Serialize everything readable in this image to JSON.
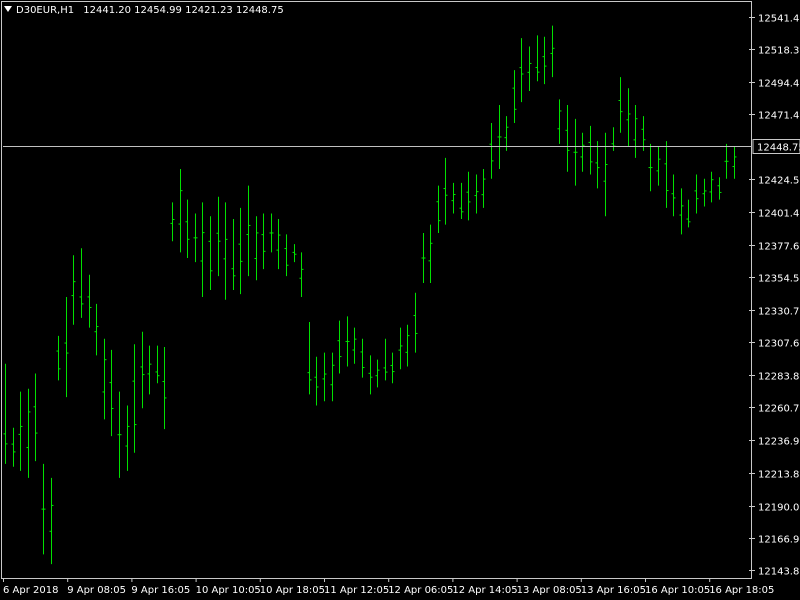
{
  "header": {
    "symbol": "D30EUR,H1",
    "open": "12441.20",
    "high": "12454.99",
    "low": "12421.23",
    "close": "12448.75"
  },
  "colors": {
    "background": "#000000",
    "bars": "#00e000",
    "grid_frame": "#c8c8c8",
    "price_line": "#c0c0c0",
    "text": "#ffffff"
  },
  "chart_data": {
    "type": "ohlc",
    "title": "",
    "xlabel": "",
    "ylabel": "",
    "ylim": [
      12138.0,
      12552.0
    ],
    "y_ticks": [
      "12541.40",
      "12518.30",
      "12494.40",
      "12471.40",
      "12424.50",
      "12401.40",
      "12377.60",
      "12354.50",
      "12330.70",
      "12307.60",
      "12283.80",
      "12260.70",
      "12236.90",
      "12213.80",
      "12190.00",
      "12166.90",
      "12143.80"
    ],
    "x_tick_labels": [
      "6 Apr 2018",
      "9 Apr 08:05",
      "9 Apr 16:05",
      "10 Apr 10:05",
      "10 Apr 18:05",
      "11 Apr 12:05",
      "12 Apr 06:05",
      "12 Apr 14:05",
      "13 Apr 08:05",
      "13 Apr 16:05",
      "16 Apr 10:05",
      "16 Apr 18:05"
    ],
    "current_price": "12448.75",
    "grid": false,
    "bars_hl": [
      [
        12292,
        12220
      ],
      [
        12246,
        12218
      ],
      [
        12272,
        12215
      ],
      [
        12274,
        12210
      ],
      [
        12285,
        12222
      ],
      [
        12220,
        12155
      ],
      [
        12210,
        12148
      ],
      [
        12312,
        12280
      ],
      [
        12340,
        12268
      ],
      [
        12370,
        12320
      ],
      [
        12375,
        12325
      ],
      [
        12356,
        12318
      ],
      [
        12335,
        12298
      ],
      [
        12310,
        12252
      ],
      [
        12302,
        12240
      ],
      [
        12272,
        12210
      ],
      [
        12262,
        12215
      ],
      [
        12306,
        12228
      ],
      [
        12315,
        12260
      ],
      [
        12305,
        12270
      ],
      [
        12305,
        12278
      ],
      [
        12304,
        12245
      ],
      [
        12408,
        12380
      ],
      [
        12432,
        12372
      ],
      [
        12410,
        12368
      ],
      [
        12400,
        12365
      ],
      [
        12408,
        12340
      ],
      [
        12398,
        12345
      ],
      [
        12412,
        12355
      ],
      [
        12408,
        12338
      ],
      [
        12396,
        12345
      ],
      [
        12404,
        12342
      ],
      [
        12420,
        12355
      ],
      [
        12398,
        12352
      ],
      [
        12400,
        12360
      ],
      [
        12400,
        12372
      ],
      [
        12396,
        12360
      ],
      [
        12385,
        12355
      ],
      [
        12378,
        12365
      ],
      [
        12372,
        12340
      ],
      [
        12322,
        12270
      ],
      [
        12297,
        12262
      ],
      [
        12300,
        12265
      ],
      [
        12300,
        12265
      ],
      [
        12323,
        12285
      ],
      [
        12326,
        12290
      ],
      [
        12318,
        12292
      ],
      [
        12310,
        12282
      ],
      [
        12298,
        12270
      ],
      [
        12295,
        12275
      ],
      [
        12310,
        12280
      ],
      [
        12300,
        12278
      ],
      [
        12318,
        12288
      ],
      [
        12320,
        12290
      ],
      [
        12343,
        12300
      ],
      [
        12386,
        12350
      ],
      [
        12392,
        12350
      ],
      [
        12420,
        12386
      ],
      [
        12440,
        12392
      ],
      [
        12422,
        12400
      ],
      [
        12422,
        12396
      ],
      [
        12430,
        12395
      ],
      [
        12428,
        12400
      ],
      [
        12432,
        12404
      ],
      [
        12465,
        12425
      ],
      [
        12478,
        12432
      ],
      [
        12470,
        12445
      ],
      [
        12503,
        12465
      ],
      [
        12526,
        12480
      ],
      [
        12520,
        12488
      ],
      [
        12528,
        12495
      ],
      [
        12527,
        12493
      ],
      [
        12535,
        12498
      ],
      [
        12482,
        12450
      ],
      [
        12478,
        12430
      ],
      [
        12468,
        12420
      ],
      [
        12458,
        12430
      ],
      [
        12463,
        12428
      ],
      [
        12452,
        12418
      ],
      [
        12458,
        12398
      ],
      [
        12462,
        12445
      ],
      [
        12498,
        12458
      ],
      [
        12490,
        12448
      ],
      [
        12478,
        12440
      ],
      [
        12470,
        12445
      ],
      [
        12450,
        12416
      ],
      [
        12448,
        12420
      ],
      [
        12452,
        12404
      ],
      [
        12428,
        12398
      ],
      [
        12418,
        12385
      ],
      [
        12410,
        12390
      ],
      [
        12428,
        12400
      ],
      [
        12425,
        12405
      ],
      [
        12430,
        12408
      ],
      [
        12426,
        12410
      ],
      [
        12450,
        12425
      ],
      [
        12448,
        12425
      ]
    ]
  }
}
